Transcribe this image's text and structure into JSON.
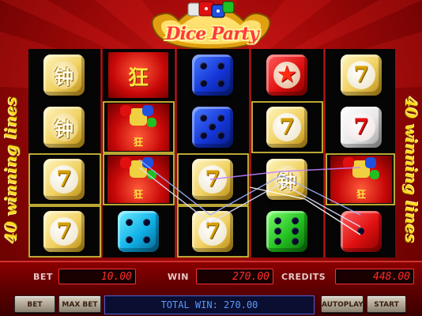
{
  "game": {
    "title": "Dice Party",
    "left_label": "40 winning lines",
    "right_label": "40 winning lines"
  },
  "reels": [
    [
      "kanji-gold-die",
      "gold-seven-die",
      "gold-seven-die",
      "gold-seven-die"
    ],
    [
      "red-kanji-card",
      "party-dice-wild",
      "party-dice-wild",
      "cyan-four-die"
    ],
    [
      "blue-four-die",
      "blue-five-die",
      "gold-seven-die",
      "gold-seven-die"
    ],
    [
      "red-star-die",
      "gold-seven-die",
      "kanji-gold-die",
      "green-six-die"
    ],
    [
      "gold-seven-die",
      "red-seven-die",
      "party-dice-wild",
      "red-cube-die"
    ]
  ],
  "symbols": {
    "kanji_char": "钟",
    "wild_char": "狂",
    "seven_char": "7"
  },
  "panel": {
    "bet_label": "BET",
    "bet_value": "10.00",
    "win_label": "WIN",
    "win_value": "270.00",
    "credits_label": "CREDITS",
    "credits_value": "448.00",
    "bet_button": "BET",
    "max_bet_button": "MAX BET",
    "total_win": "TOTAL WIN: 270.00",
    "autoplay_button": "AUTOPLAY",
    "start_button": "START"
  },
  "colors": {
    "background": "#a00808",
    "lcd_text": "#ff2a2a",
    "total_win_text": "#5a9aff",
    "win_frame": "#e8d040",
    "label_gold": "#ffd820"
  }
}
